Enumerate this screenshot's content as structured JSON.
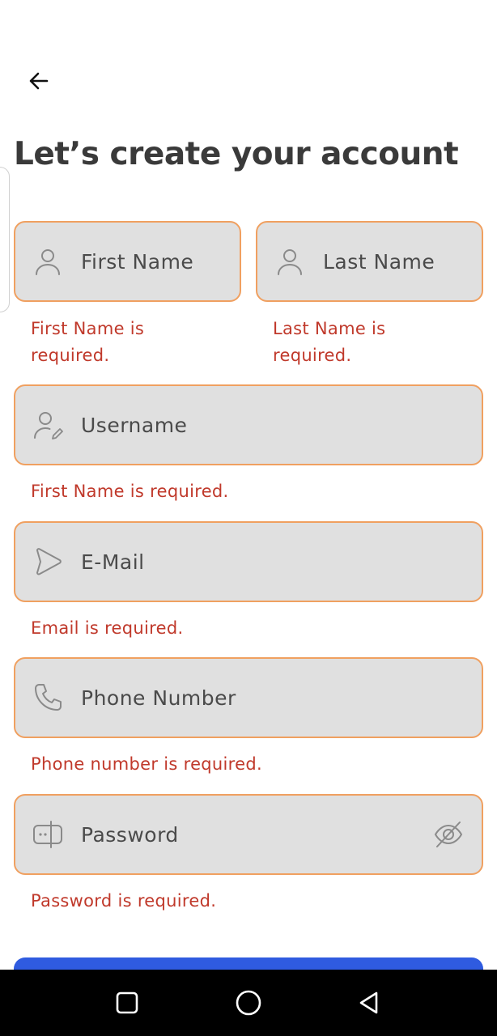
{
  "header": {
    "back_icon": "arrow-left-icon",
    "title": "Let’s create your account"
  },
  "form": {
    "first_name": {
      "placeholder": "First Name",
      "icon": "user-icon",
      "error": "First Name is required."
    },
    "last_name": {
      "placeholder": "Last Name",
      "icon": "user-icon",
      "error": "Last Name is required."
    },
    "username": {
      "placeholder": "Username",
      "icon": "user-edit-icon",
      "error": "First Name is required."
    },
    "email": {
      "placeholder": "E-Mail",
      "icon": "send-icon",
      "error": "Email is required."
    },
    "phone": {
      "placeholder": "Phone Number",
      "icon": "phone-icon",
      "error": "Phone number is required."
    },
    "password": {
      "placeholder": "Password",
      "icon": "password-check-icon",
      "toggle_icon": "eye-slash-icon",
      "error": "Password is required."
    }
  },
  "colors": {
    "field_border": "#f0a060",
    "field_bg": "#e0e0e0",
    "error": "#c0392b",
    "primary": "#2f5be0"
  },
  "nav_bar": {
    "buttons": [
      "recents-square-icon",
      "home-circle-icon",
      "back-triangle-icon"
    ]
  }
}
